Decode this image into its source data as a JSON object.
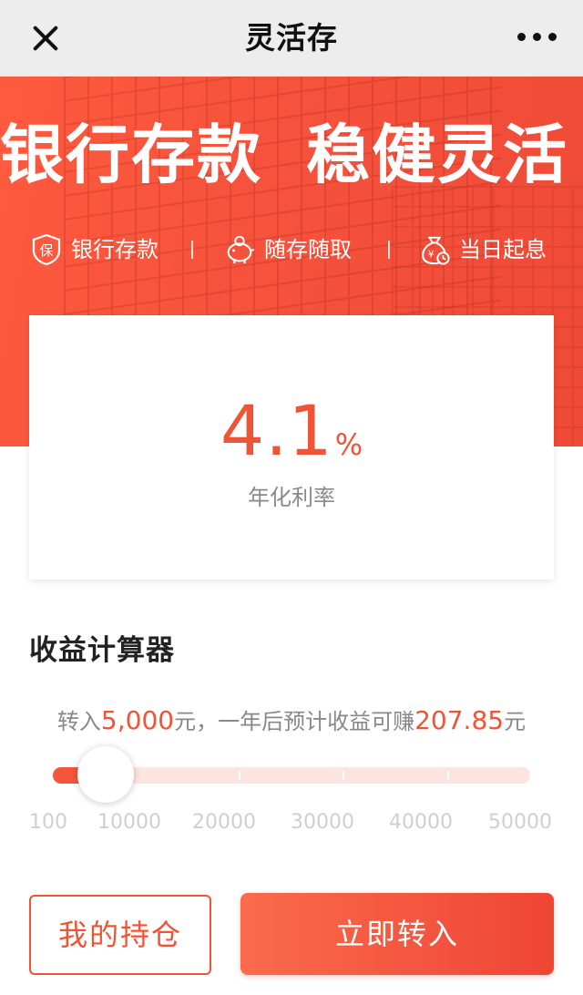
{
  "nav": {
    "title": "灵活存"
  },
  "banner": {
    "slogan_left": "银行存款",
    "slogan_right": "稳健灵活",
    "features": [
      {
        "label": "银行存款",
        "icon": "shield-icon"
      },
      {
        "label": "随存随取",
        "icon": "piggy-bank-icon"
      },
      {
        "label": "当日起息",
        "icon": "money-bag-clock-icon"
      }
    ]
  },
  "rate_card": {
    "rate": "4.1",
    "unit": "%",
    "label": "年化利率"
  },
  "calculator": {
    "title": "收益计算器",
    "desc_prefix": "转入",
    "amount": "5,000",
    "desc_mid": "元，一年后预计收益可赚",
    "earnings": "207.85",
    "desc_suffix": "元",
    "slider_value": 5000,
    "slider_min": 100,
    "slider_max": 50000,
    "scale_labels": [
      "100",
      "10000",
      "20000",
      "30000",
      "40000",
      "50000"
    ]
  },
  "actions": {
    "holdings_label": "我的持仓",
    "transfer_label": "立即转入"
  },
  "colors": {
    "accent": "#ef5436",
    "banner": "#f6523c",
    "slider_track": "#fde5df"
  }
}
